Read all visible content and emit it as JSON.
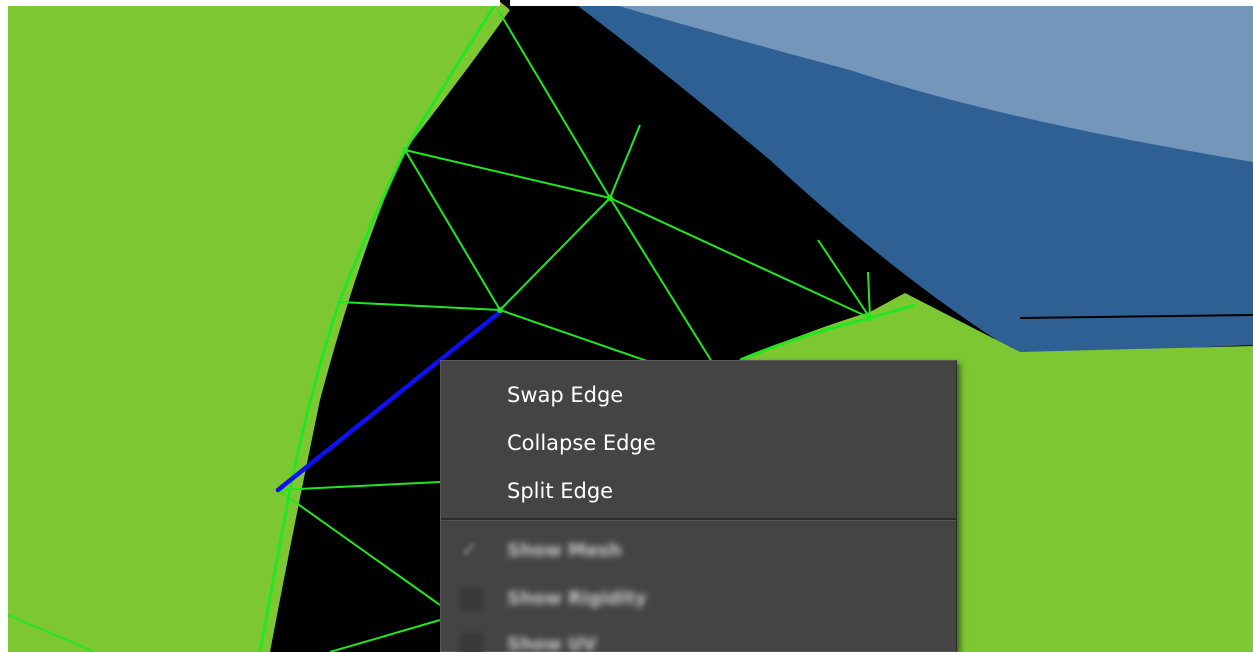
{
  "canvas": {
    "colors": {
      "background": "#000000",
      "mesh_fill": "#7dc832",
      "mesh_edge": "#22e622",
      "selected_edge": "#1010ee",
      "shape_dark": "#2e6094",
      "shape_light": "#7496ba"
    },
    "selected_edge_label": ""
  },
  "context_menu": {
    "items": [
      {
        "label": "Swap Edge"
      },
      {
        "label": "Collapse Edge"
      },
      {
        "label": "Split Edge"
      }
    ],
    "toggles": [
      {
        "label": "Show Mesh",
        "checked": true,
        "icon": "checkmark-icon"
      },
      {
        "label": "Show Rigidity",
        "checked": false,
        "icon": "checkbox-icon"
      },
      {
        "label": "Show UV",
        "checked": false,
        "icon": "checkbox-icon"
      }
    ]
  }
}
